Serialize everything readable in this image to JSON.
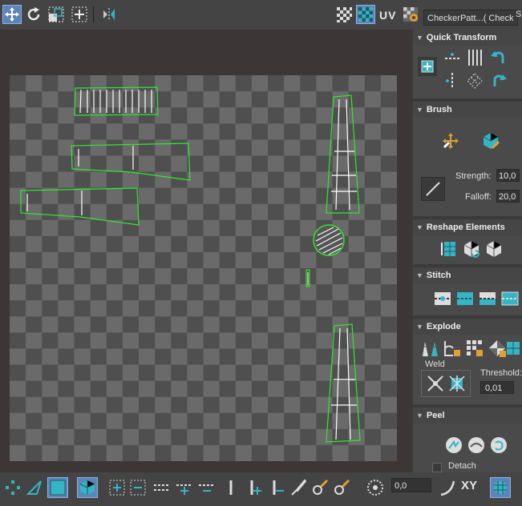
{
  "toolbar": {
    "uv_label": "UV",
    "texture_combo": "CheckerPatt...( Check",
    "panel_partial_letter": "S",
    "icons": [
      "move-icon",
      "rotate-icon",
      "scale-icon",
      "freeform-icon",
      "mirror-icon",
      "show-grid-icon",
      "show-checker-icon",
      "uv-mode-icon",
      "settings-icon"
    ]
  },
  "panel": {
    "quick_transform": {
      "title": "Quick Transform"
    },
    "brush": {
      "title": "Brush",
      "strength_label": "Strength:",
      "strength_value": "10,0",
      "falloff_label": "Falloff:",
      "falloff_value": "20,0"
    },
    "reshape": {
      "title": "Reshape Elements"
    },
    "stitch": {
      "title": "Stitch"
    },
    "explode": {
      "title": "Explode",
      "weld_label": "Weld",
      "threshold_label": "Threshold:",
      "threshold_value": "0,01"
    },
    "peel": {
      "title": "Peel",
      "detach_label": "Detach"
    }
  },
  "bottom": {
    "angle_value": "0,0",
    "xy_label": "XY"
  },
  "colors": {
    "uv_edge": "#2ee82e",
    "seam": "#ffffff",
    "accent": "#35b4c4",
    "selected": "#5b84b8",
    "checker_dark": "#4f4f4f",
    "checker_light": "#6a6a6a",
    "viewport_bg": "#3d3637"
  }
}
